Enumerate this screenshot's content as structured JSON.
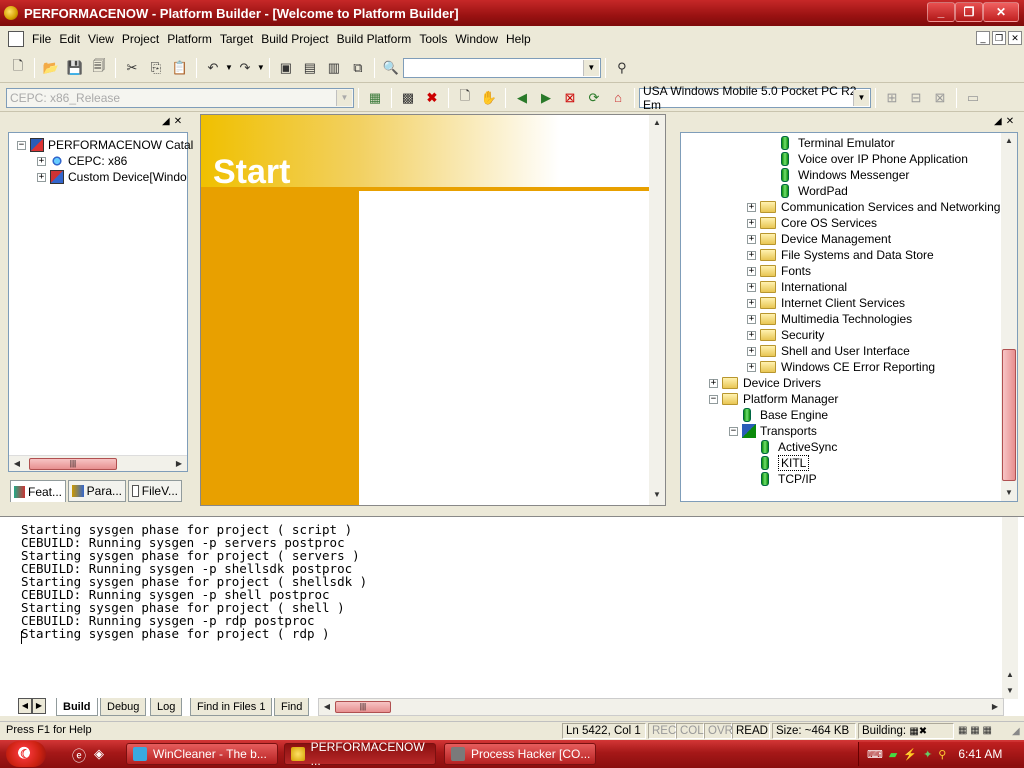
{
  "window": {
    "title": "PERFORMACENOW - Platform Builder - [Welcome to Platform Builder]"
  },
  "menu": [
    "File",
    "Edit",
    "View",
    "Project",
    "Platform",
    "Target",
    "Build Project",
    "Build Platform",
    "Tools",
    "Window",
    "Help"
  ],
  "toolbar": {
    "find_combo_value": "",
    "config_combo_value": "CEPC: x86_Release",
    "sdk_combo_value": "USA Windows Mobile 5.0 Pocket PC R2 Em"
  },
  "left_tree": {
    "items": [
      {
        "label": "PERFORMACENOW Catal",
        "expander": "−",
        "icon": "project-icon"
      },
      {
        "label": "CEPC: x86",
        "expander": "+",
        "icon": "cepc-node-icon"
      },
      {
        "label": "Custom Device[Windo",
        "expander": "+",
        "icon": "device-icon"
      }
    ],
    "tabs": [
      "Feat...",
      "Para...",
      "FileV..."
    ]
  },
  "welcome": {
    "heading": "Start"
  },
  "right_tree": {
    "items": [
      {
        "label": "Terminal Emulator",
        "type": "component",
        "level": 3
      },
      {
        "label": "Voice over IP Phone Application",
        "type": "component",
        "level": 3
      },
      {
        "label": "Windows Messenger",
        "type": "component",
        "level": 3
      },
      {
        "label": "WordPad",
        "type": "component",
        "level": 3
      },
      {
        "label": "Communication Services and Networking",
        "type": "folder",
        "level": 2
      },
      {
        "label": "Core OS Services",
        "type": "folder",
        "level": 2
      },
      {
        "label": "Device Management",
        "type": "folder",
        "level": 2
      },
      {
        "label": "File Systems and Data Store",
        "type": "folder",
        "level": 2
      },
      {
        "label": "Fonts",
        "type": "folder",
        "level": 2
      },
      {
        "label": "International",
        "type": "folder",
        "level": 2
      },
      {
        "label": "Internet Client Services",
        "type": "folder",
        "level": 2
      },
      {
        "label": "Multimedia Technologies",
        "type": "folder",
        "level": 2
      },
      {
        "label": "Security",
        "type": "folder",
        "level": 2
      },
      {
        "label": "Shell and User Interface",
        "type": "folder",
        "level": 2
      },
      {
        "label": "Windows CE Error Reporting",
        "type": "folder",
        "level": 2
      },
      {
        "label": "Device Drivers",
        "type": "folder",
        "level": 0
      },
      {
        "label": "Platform Manager",
        "type": "folder-open",
        "level": 0
      },
      {
        "label": "Base Engine",
        "type": "component",
        "level": 1
      },
      {
        "label": "Transports",
        "type": "group",
        "level": 1
      },
      {
        "label": "ActiveSync",
        "type": "component",
        "level": 2
      },
      {
        "label": "KITL",
        "type": "component-selected",
        "level": 2
      },
      {
        "label": "TCP/IP",
        "type": "component",
        "level": 2
      }
    ]
  },
  "output": {
    "lines": [
      "Starting sysgen phase for project ( script )",
      "CEBUILD: Running sysgen -p servers postproc",
      "Starting sysgen phase for project ( servers )",
      "CEBUILD: Running sysgen -p shellsdk postproc",
      "Starting sysgen phase for project ( shellsdk )",
      "CEBUILD: Running sysgen -p shell postproc",
      "Starting sysgen phase for project ( shell )",
      "CEBUILD: Running sysgen -p rdp postproc",
      "Starting sysgen phase for project ( rdp )"
    ],
    "tabs": [
      "Build",
      "Debug",
      "Log",
      "Find in Files 1",
      "Find"
    ]
  },
  "status": {
    "help": "Press F1 for Help",
    "position": "Ln 5422, Col 1",
    "rec": "REC",
    "col": "COL",
    "ovr": "OVR",
    "read": "READ",
    "size": "Size: ~464 KB",
    "building": "Building:"
  },
  "taskbar": {
    "tasks": [
      {
        "label": "WinCleaner - The b...",
        "active": false
      },
      {
        "label": "PERFORMACENOW ...",
        "active": true
      },
      {
        "label": "Process Hacker [CO...",
        "active": false
      }
    ],
    "clock": "6:41 AM"
  },
  "colors": {
    "title": "#b01c1c",
    "accent": "#e8a000",
    "selection": "#316ac5"
  }
}
